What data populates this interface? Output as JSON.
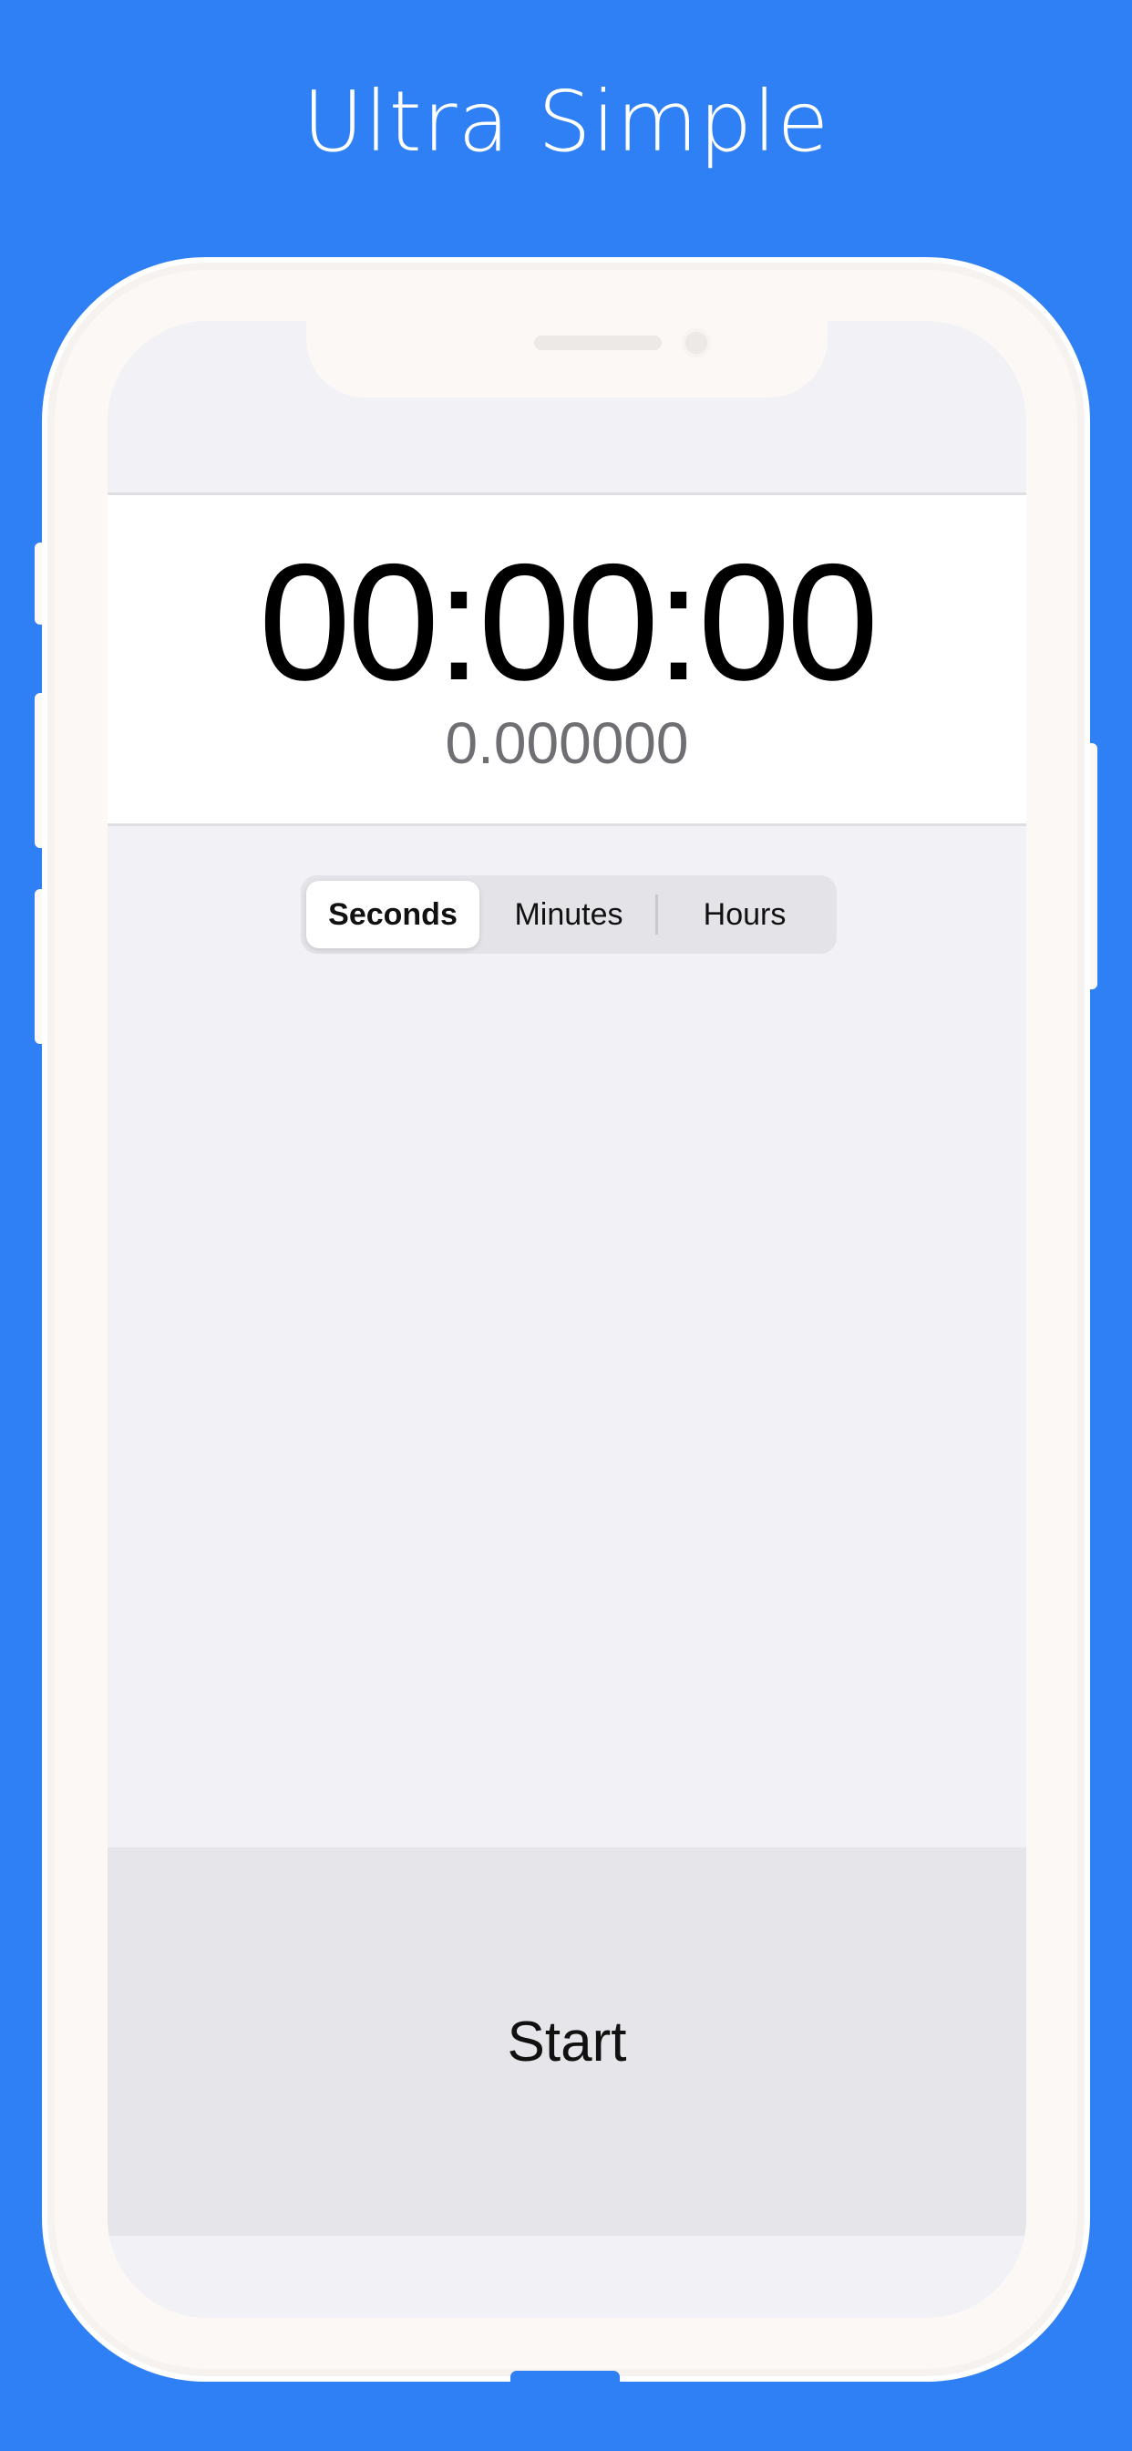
{
  "headline": "Ultra Simple",
  "timer": {
    "display": "00:00:00",
    "decimal": "0.000000"
  },
  "units": {
    "options": [
      "Seconds",
      "Minutes",
      "Hours"
    ],
    "selected": "Seconds"
  },
  "actions": {
    "start_label": "Start"
  },
  "colors": {
    "background": "#2F7FF5",
    "screen": "#F1F1F6",
    "card": "#FFFFFF",
    "start_bar": "#E5E5EA",
    "segmented_bg": "#E3E3E8"
  }
}
